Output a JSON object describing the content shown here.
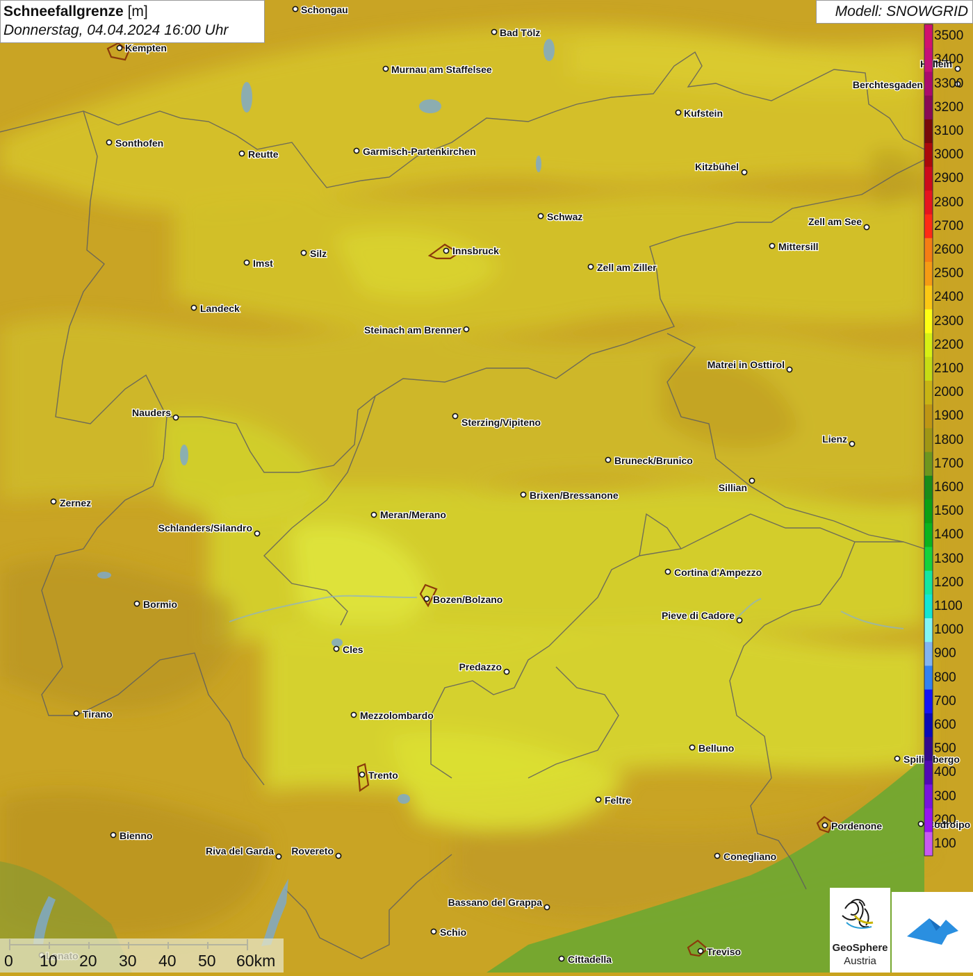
{
  "header": {
    "title": "Schneefallgrenze",
    "unit": "[m]",
    "datetime": "Donnerstag, 04.04.2024 16:00 Uhr"
  },
  "model_label": "Modell: SNOWGRID",
  "legend": {
    "values": [
      "3500",
      "3400",
      "3300",
      "3200",
      "3100",
      "3000",
      "2900",
      "2800",
      "2700",
      "2600",
      "2500",
      "2400",
      "2300",
      "2200",
      "2100",
      "2000",
      "1900",
      "1800",
      "1700",
      "1600",
      "1500",
      "1400",
      "1300",
      "1200",
      "1100",
      "1000",
      "900",
      "800",
      "700",
      "600",
      "500",
      "400",
      "300",
      "200",
      "100"
    ],
    "colors": [
      "#d0116e",
      "#c51177",
      "#aa0a6c",
      "#880a55",
      "#770a0a",
      "#aa0a0a",
      "#cc0a1a",
      "#e6141e",
      "#ff2a14",
      "#f57d14",
      "#f59b14",
      "#fbc814",
      "#ffff14",
      "#d7f014",
      "#c8dc14",
      "#c8b414",
      "#be9614",
      "#a09614",
      "#6e961e",
      "#198c19",
      "#0aa014",
      "#0ab41e",
      "#14d23c",
      "#14e6a0",
      "#14e6d2",
      "#82f5f5",
      "#82b4f0",
      "#3282f0",
      "#1414f5",
      "#0a0ab4",
      "#320a8c",
      "#500ab4",
      "#7814dc",
      "#9614f0",
      "#c85af0"
    ]
  },
  "places": [
    {
      "name": "Schongau"
    },
    {
      "name": "Bad Tölz"
    },
    {
      "name": "Kempten"
    },
    {
      "name": "Murnau am Staffelsee"
    },
    {
      "name": "Hallein"
    },
    {
      "name": "Berchtesgaden"
    },
    {
      "name": "Kufstein"
    },
    {
      "name": "Sonthofen"
    },
    {
      "name": "Reutte"
    },
    {
      "name": "Garmisch-Partenkirchen"
    },
    {
      "name": "Kitzbühel"
    },
    {
      "name": "Schwaz"
    },
    {
      "name": "Zell am See"
    },
    {
      "name": "Mittersill"
    },
    {
      "name": "Innsbruck"
    },
    {
      "name": "Silz"
    },
    {
      "name": "Imst"
    },
    {
      "name": "Zell am Ziller"
    },
    {
      "name": "Landeck"
    },
    {
      "name": "Steinach am Brenner"
    },
    {
      "name": "Matrei in Osttirol"
    },
    {
      "name": "Nauders"
    },
    {
      "name": "Sterzing/Vipiteno"
    },
    {
      "name": "Lienz"
    },
    {
      "name": "Bruneck/Brunico"
    },
    {
      "name": "Sillian"
    },
    {
      "name": "Brixen/Bressanone"
    },
    {
      "name": "Zernez"
    },
    {
      "name": "Meran/Merano"
    },
    {
      "name": "Schlanders/Silandro"
    },
    {
      "name": "Cortina d'Ampezzo"
    },
    {
      "name": "Bozen/Bolzano"
    },
    {
      "name": "Bormio"
    },
    {
      "name": "Pieve di Cadore"
    },
    {
      "name": "Cles"
    },
    {
      "name": "Predazzo"
    },
    {
      "name": "Tirano"
    },
    {
      "name": "Mezzolombardo"
    },
    {
      "name": "Belluno"
    },
    {
      "name": "Spilimbergo"
    },
    {
      "name": "Trento"
    },
    {
      "name": "Feltre"
    },
    {
      "name": "Pordenone"
    },
    {
      "name": "Codroipo"
    },
    {
      "name": "Bienno"
    },
    {
      "name": "Riva del Garda"
    },
    {
      "name": "Rovereto"
    },
    {
      "name": "Conegliano"
    },
    {
      "name": "Bassano del Grappa"
    },
    {
      "name": "Schio"
    },
    {
      "name": "Treviso"
    },
    {
      "name": "Cittadella"
    },
    {
      "name": "Lonato"
    }
  ],
  "scale_bar": {
    "labels": [
      "0",
      "10",
      "20",
      "30",
      "40",
      "50",
      "60km"
    ]
  },
  "logos": {
    "geosphere_line1": "GeoSphere",
    "geosphere_line2": "Austria"
  }
}
